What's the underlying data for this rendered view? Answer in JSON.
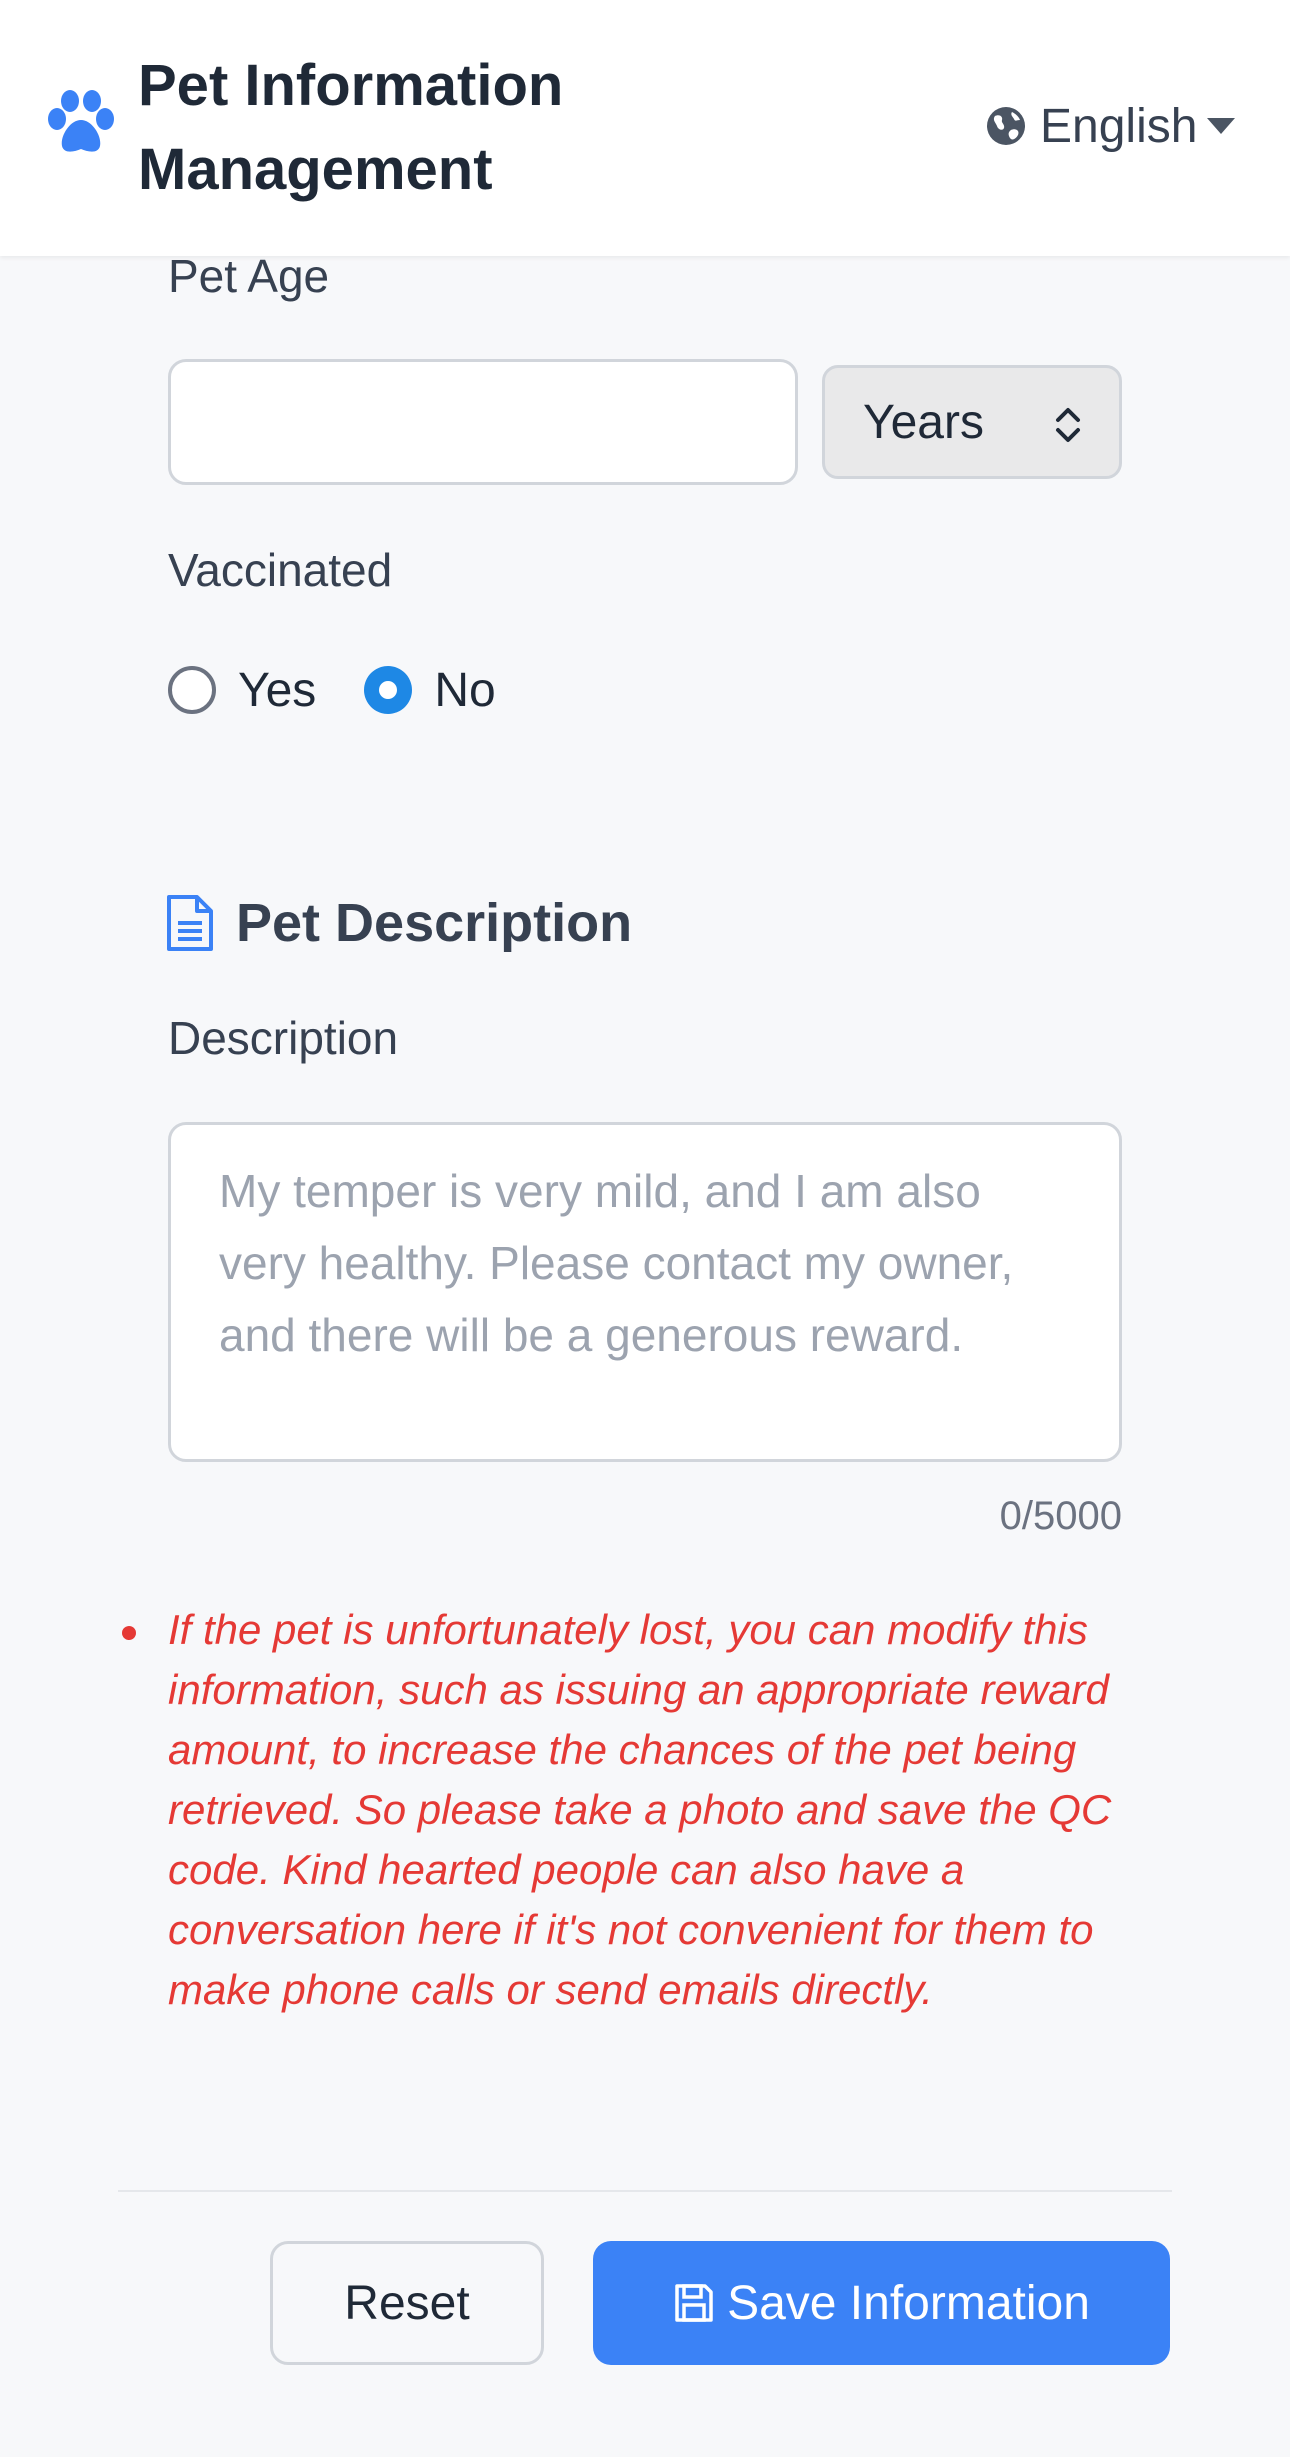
{
  "header": {
    "title": "Pet Information Management",
    "language": "English",
    "icons": {
      "logo": "paw-icon",
      "language": "globe-icon",
      "dropdown": "caret-down-icon"
    }
  },
  "form": {
    "age": {
      "label": "Pet Age",
      "value": "",
      "unit": "Years"
    },
    "vaccinated": {
      "label": "Vaccinated",
      "options": [
        "Yes",
        "No"
      ],
      "selected": "No"
    },
    "description_section": {
      "title": "Pet Description",
      "label": "Description",
      "placeholder": "My temper is very mild, and I am also very healthy. Please contact my owner, and there will be a generous reward.",
      "counter": "0/5000"
    },
    "notice": "If the pet is unfortunately lost, you can modify this information, such as issuing an appropriate reward amount, to increase the chances of the pet being retrieved. So please take a photo and save the QC code. Kind hearted people can also have a conversation here if it's not convenient for them to make phone calls or send emails directly."
  },
  "actions": {
    "reset_label": "Reset",
    "save_label": "Save Information"
  },
  "colors": {
    "accent": "#3b82f6",
    "radio_checked": "#1e88e5",
    "notice": "#e53935",
    "background": "#f7f8fa"
  }
}
